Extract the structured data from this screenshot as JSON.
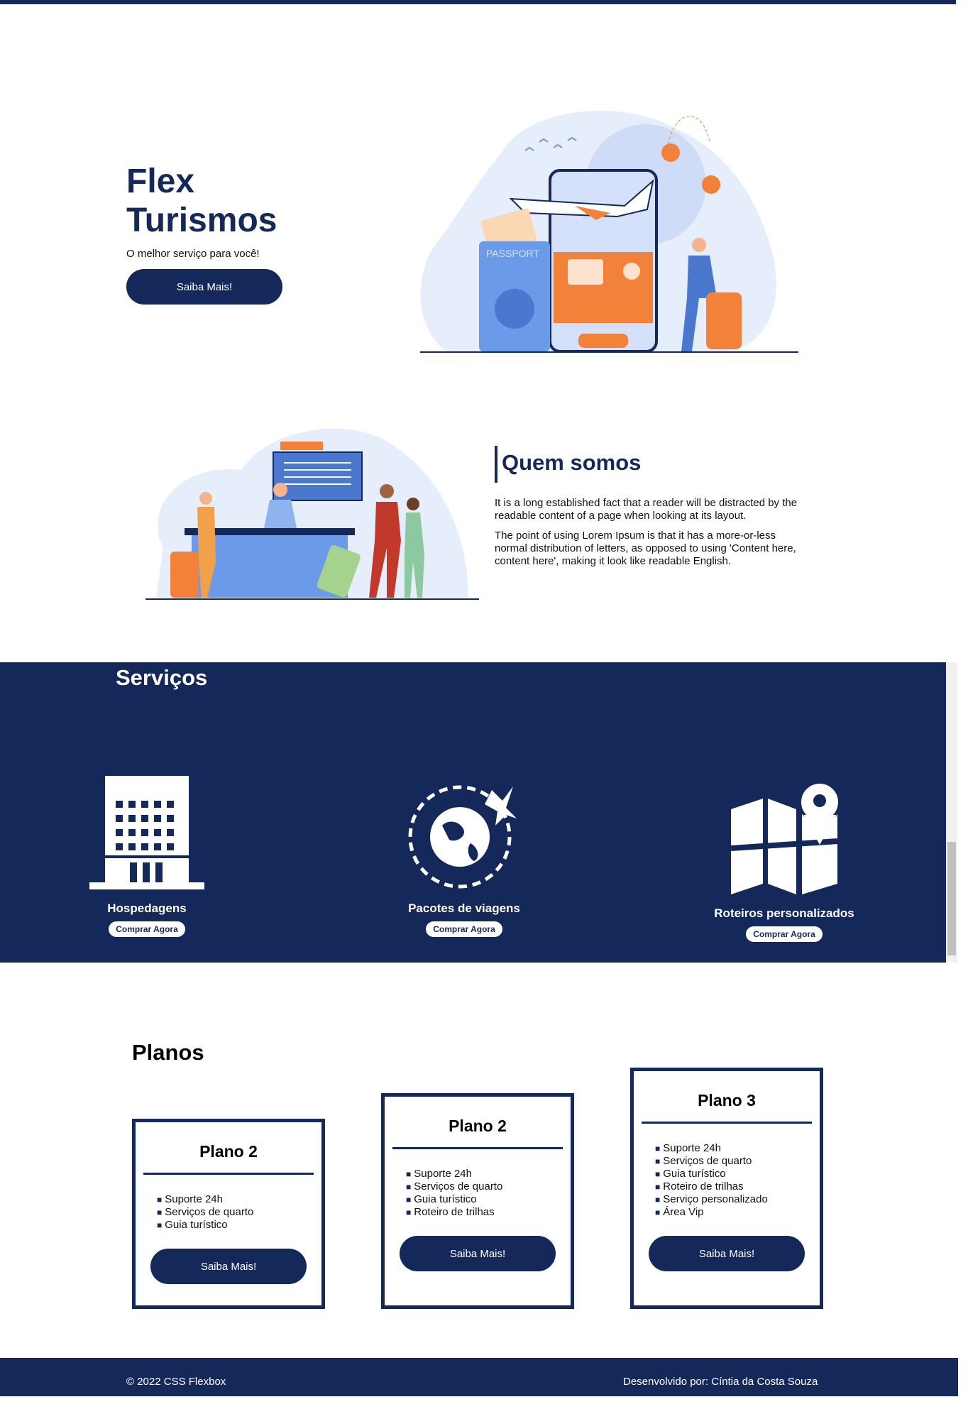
{
  "hero": {
    "title": "Flex Turismos",
    "subtitle": "O melhor serviço para você!",
    "button": "Saiba Mais!",
    "passport_label": "PASSPORT"
  },
  "about": {
    "title": "Quem somos",
    "paragraph1": "It is a long established fact that a reader will be distracted by the readable content of a page when looking at its layout.",
    "paragraph2": "The point of using Lorem Ipsum is that it has a more-or-less normal distribution of letters, as opposed to using 'Content here, content here', making it look like readable English."
  },
  "services": {
    "title": "Serviços",
    "items": [
      {
        "label": "Hospedagens",
        "button": "Comprar Agora",
        "icon": "hotel-icon"
      },
      {
        "label": "Pacotes de viagens",
        "button": "Comprar Agora",
        "icon": "globe-plane-icon"
      },
      {
        "label": "Roteiros personalizados",
        "button": "Comprar Agora",
        "icon": "map-pin-icon"
      }
    ]
  },
  "plans": {
    "title": "Planos",
    "items": [
      {
        "name": "Plano 2",
        "features": [
          "Suporte 24h",
          "Serviços de quarto",
          "Guia turístico"
        ],
        "button": "Saiba Mais!"
      },
      {
        "name": "Plano 2",
        "features": [
          "Suporte 24h",
          "Serviços de quarto",
          "Guia turístico",
          "Roteiro de trilhas"
        ],
        "button": "Saiba Mais!"
      },
      {
        "name": "Plano 3",
        "features": [
          "Suporte 24h",
          "Serviços de quarto",
          "Guia turístico",
          "Roteiro de trilhas",
          "Serviço personalizado",
          "Área Vip"
        ],
        "button": "Saiba Mais!"
      }
    ]
  },
  "footer": {
    "copyright": "© 2022 CSS Flexbox",
    "developer": "Desenvolvido por: Cíntia da Costa Souza"
  },
  "colors": {
    "primary": "#14295a",
    "accent": "#f2813a",
    "light_blue": "#e6eefc",
    "mid_blue": "#6b9be8"
  }
}
